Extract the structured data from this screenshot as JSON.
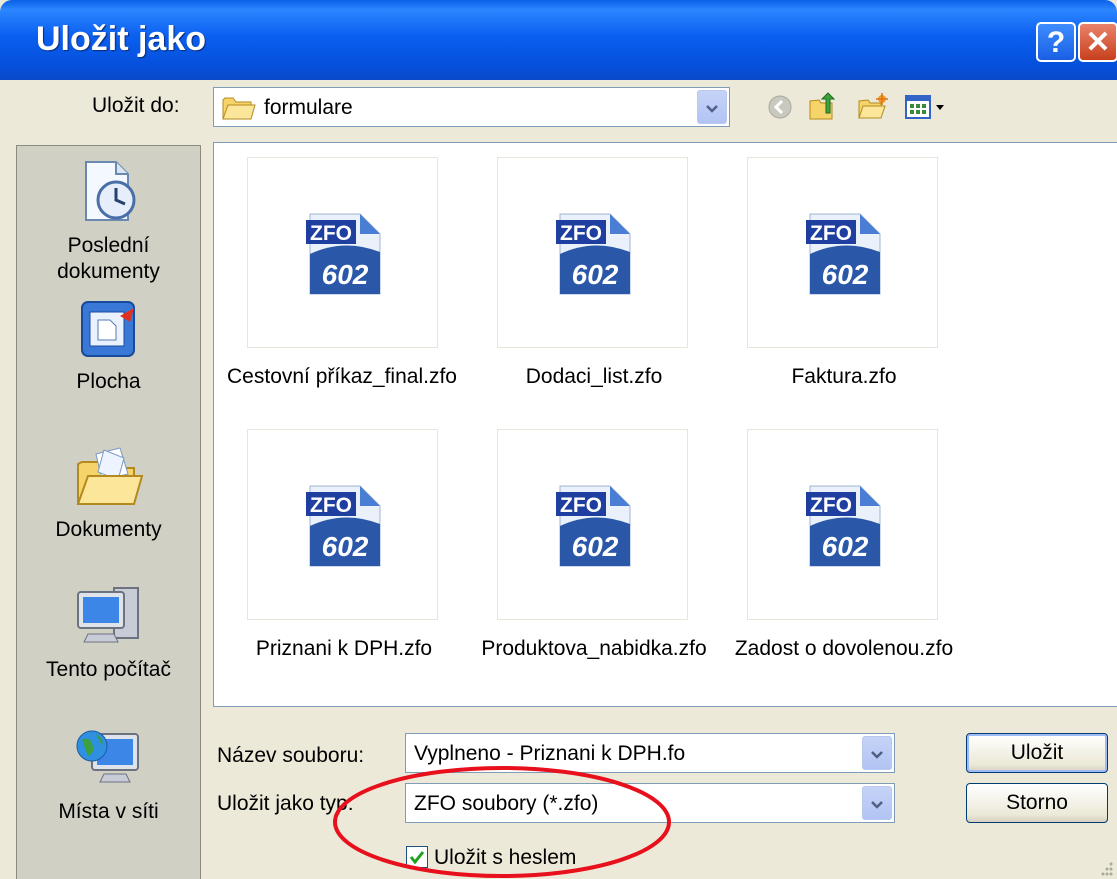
{
  "window": {
    "title": "Uložit jako",
    "help_glyph": "?",
    "close_glyph": "✕"
  },
  "savein": {
    "label": "Uložit do:",
    "value": "formulare"
  },
  "places": [
    {
      "label_line1": "Poslední",
      "label_line2": "dokumenty",
      "icon": "recent-documents-icon"
    },
    {
      "label_line1": "Plocha",
      "label_line2": "",
      "icon": "desktop-icon"
    },
    {
      "label_line1": "Dokumenty",
      "label_line2": "",
      "icon": "my-documents-icon"
    },
    {
      "label_line1": "Tento počítač",
      "label_line2": "",
      "icon": "my-computer-icon"
    },
    {
      "label_line1": "Místa v síti",
      "label_line2": "",
      "icon": "network-places-icon"
    }
  ],
  "files": [
    {
      "name": "Cestovní příkaz_final.zfo"
    },
    {
      "name": "Dodaci_list.zfo"
    },
    {
      "name": "Faktura.zfo"
    },
    {
      "name": "Priznani k DPH.zfo"
    },
    {
      "name": "Produktova_nabidka.zfo"
    },
    {
      "name": "Zadost o dovolenou.zfo"
    }
  ],
  "file_icon": {
    "top_text": "ZFO",
    "bottom_text": "602"
  },
  "filename": {
    "label": "Název souboru:",
    "value": "Vyplneno - Priznani k DPH.fo"
  },
  "filetype": {
    "label": "Uložit jako typ:",
    "value": "ZFO soubory (*.zfo)"
  },
  "buttons": {
    "save": "Uložit",
    "cancel": "Storno"
  },
  "checkbox": {
    "label": "Uložit s heslem",
    "checked": true
  },
  "colors": {
    "titlebar": "#0a5fe8",
    "annotation": "#e8101c",
    "dialog_bg": "#ece9d8"
  }
}
